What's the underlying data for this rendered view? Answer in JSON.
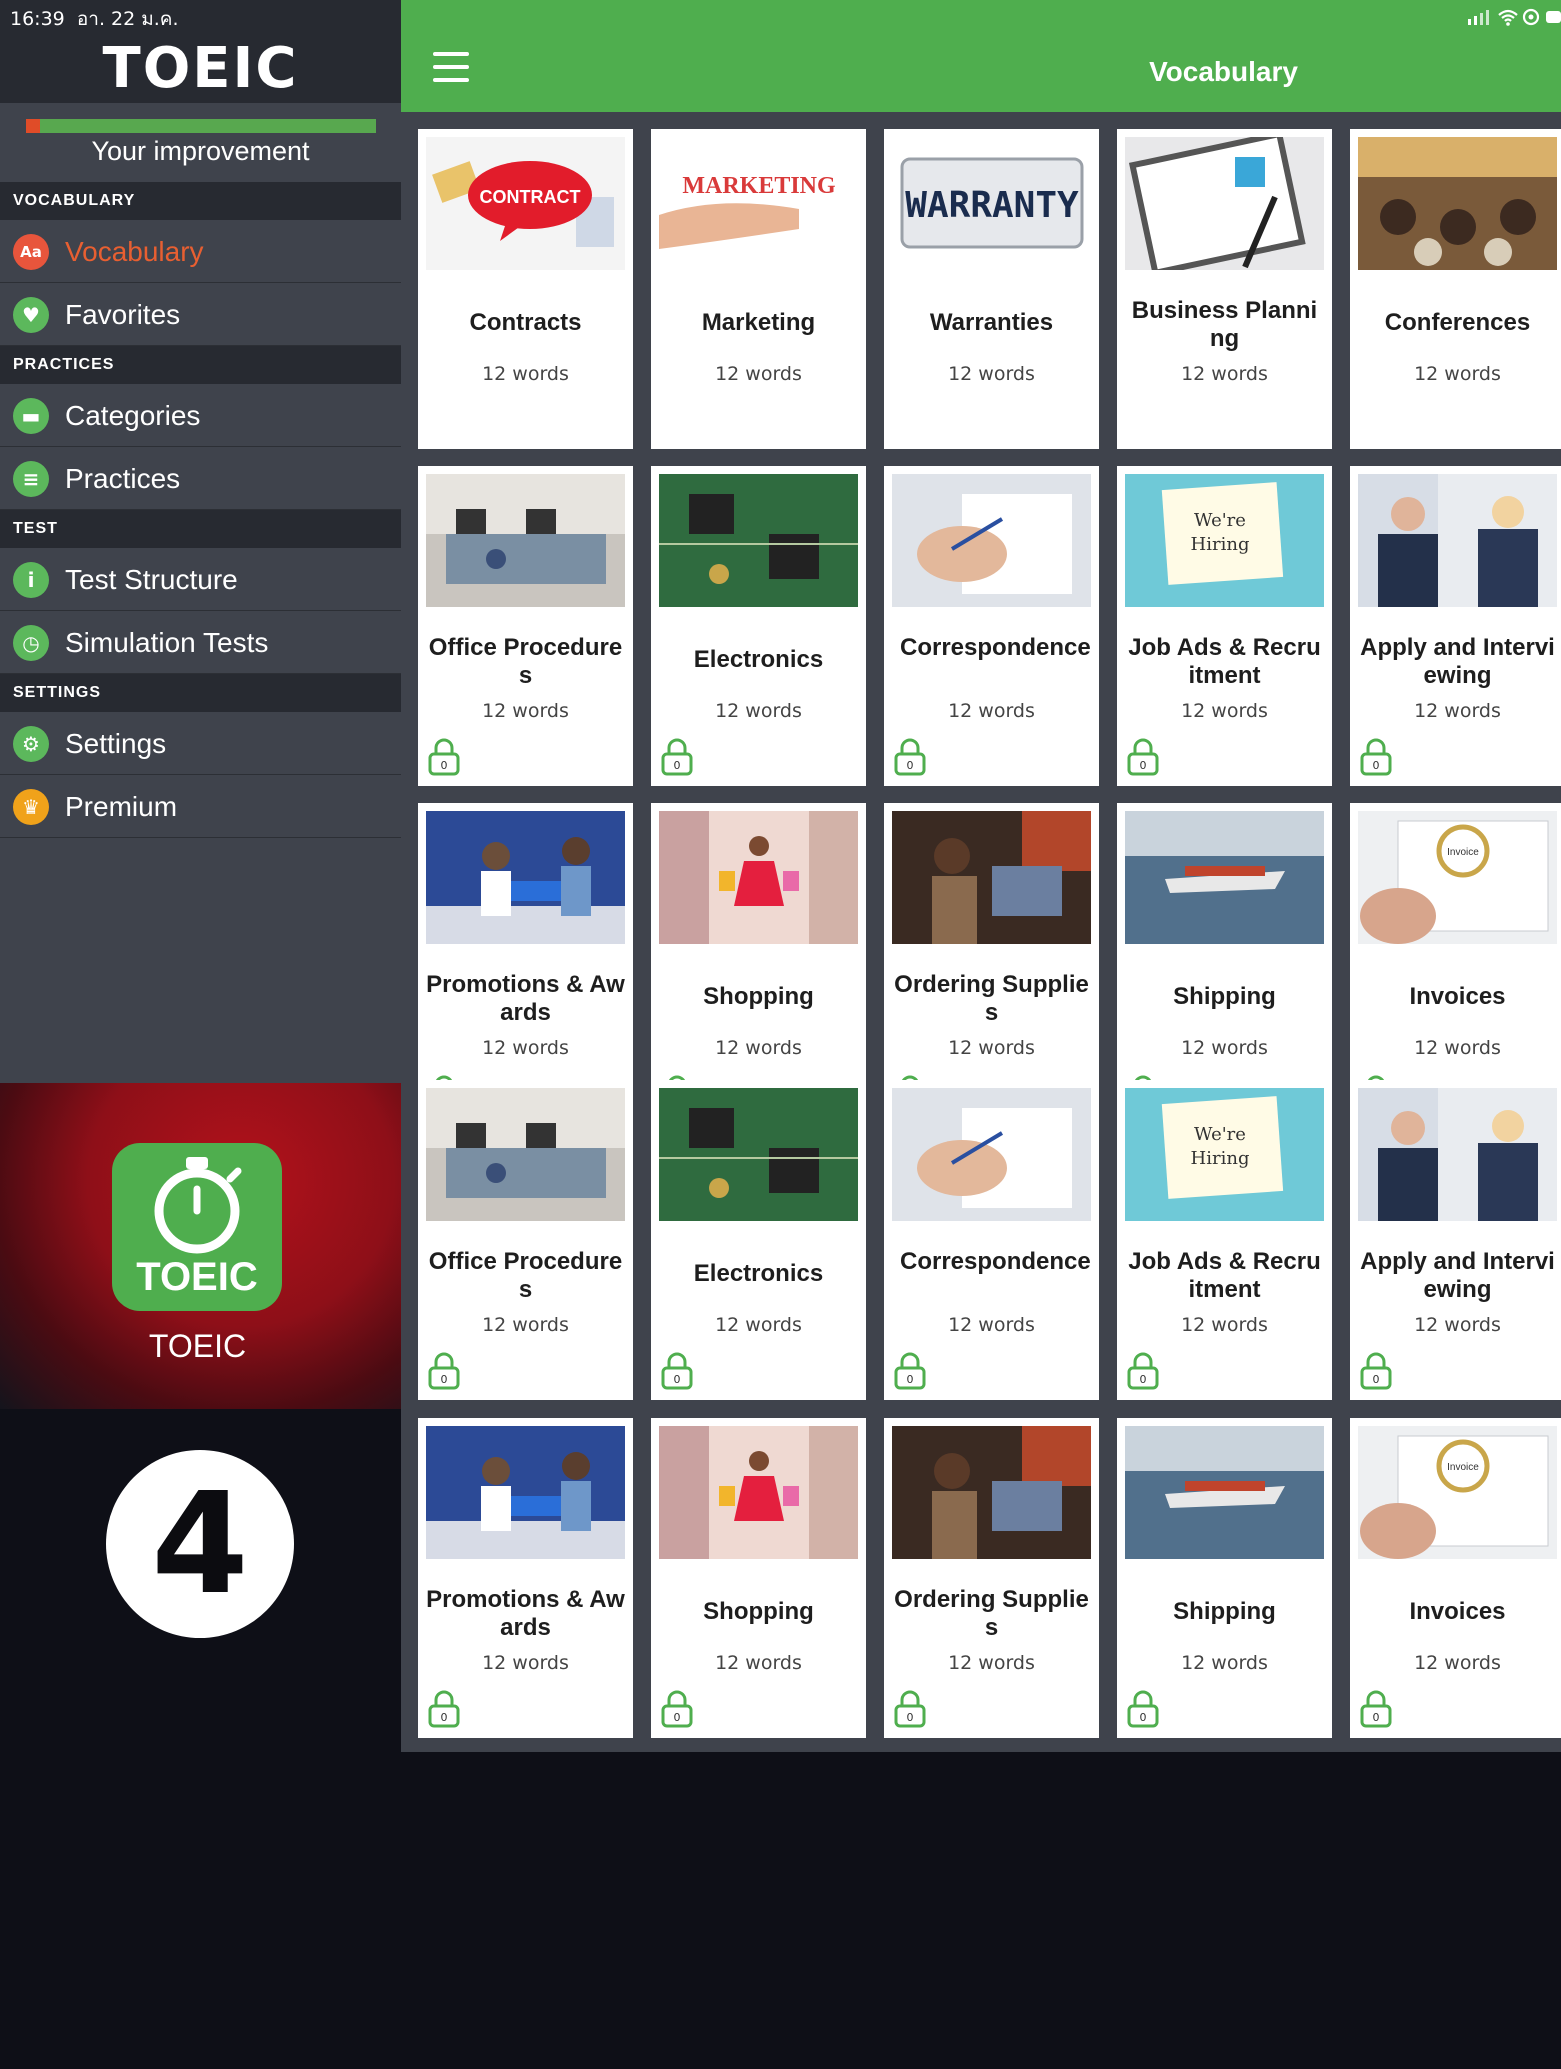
{
  "status_bar": {
    "time": "16:39",
    "date": "อา. 22 ม.ค."
  },
  "app": {
    "logo_text": "TOEIC"
  },
  "sidebar": {
    "improvement_label": "Your improvement",
    "improvement_progress": 0.04,
    "sections": [
      {
        "label": "VOCABULARY",
        "items": [
          {
            "label": "Vocabulary",
            "icon": "vocabulary-book-icon",
            "active": true
          },
          {
            "label": "Favorites",
            "icon": "heart-icon",
            "active": false
          }
        ]
      },
      {
        "label": "PRACTICES",
        "items": [
          {
            "label": "Categories",
            "icon": "folder-icon",
            "active": false
          },
          {
            "label": "Practices",
            "icon": "clipboard-icon",
            "active": false
          }
        ]
      },
      {
        "label": "TEST",
        "items": [
          {
            "label": "Test Structure",
            "icon": "info-icon",
            "active": false
          },
          {
            "label": "Simulation Tests",
            "icon": "stopwatch-icon",
            "active": false
          }
        ]
      },
      {
        "label": "SETTINGS",
        "items": [
          {
            "label": "Settings",
            "icon": "gear-icon",
            "active": false
          },
          {
            "label": "Premium",
            "icon": "crown-icon",
            "active": false
          }
        ]
      }
    ]
  },
  "header": {
    "title": "Vocabulary"
  },
  "promo": {
    "badge_text": "TOEIC",
    "title": "TOEIC",
    "step_number": "4"
  },
  "lock_count": "0",
  "rows": [
    [
      {
        "title": "Contracts",
        "count": "12 words",
        "locked": false,
        "img": "contract"
      },
      {
        "title": "Marketing",
        "count": "12 words",
        "locked": false,
        "img": "marketing"
      },
      {
        "title": "Warranties",
        "count": "12 words",
        "locked": false,
        "img": "warranty"
      },
      {
        "title": "Business Planning",
        "count": "12 words",
        "locked": false,
        "img": "plan"
      },
      {
        "title": "Conferences",
        "count": "12 words",
        "locked": false,
        "img": "conference"
      }
    ],
    [
      {
        "title": "Office Procedures",
        "count": "12 words",
        "locked": true,
        "img": "office"
      },
      {
        "title": "Electronics",
        "count": "12 words",
        "locked": true,
        "img": "circuit"
      },
      {
        "title": "Correspondence",
        "count": "12 words",
        "locked": true,
        "img": "writing"
      },
      {
        "title": "Job Ads & Recruitment",
        "count": "12 words",
        "locked": true,
        "img": "hiring"
      },
      {
        "title": "Apply and Interviewing",
        "count": "12 words",
        "locked": true,
        "img": "interview"
      }
    ],
    [
      {
        "title": "Promotions & Awards",
        "count": "12 words",
        "locked": true,
        "img": "award"
      },
      {
        "title": "Shopping",
        "count": "12 words",
        "locked": true,
        "img": "shopping"
      },
      {
        "title": "Ordering Supplies",
        "count": "12 words",
        "locked": true,
        "img": "ordering"
      },
      {
        "title": "Shipping",
        "count": "12 words",
        "locked": true,
        "img": "ship"
      },
      {
        "title": "Invoices",
        "count": "12 words",
        "locked": true,
        "img": "invoice"
      }
    ],
    [
      {
        "title": "Office Procedures",
        "count": "12 words",
        "locked": true,
        "img": "office"
      },
      {
        "title": "Electronics",
        "count": "12 words",
        "locked": true,
        "img": "circuit"
      },
      {
        "title": "Correspondence",
        "count": "12 words",
        "locked": true,
        "img": "writing"
      },
      {
        "title": "Job Ads & Recruitment",
        "count": "12 words",
        "locked": true,
        "img": "hiring"
      },
      {
        "title": "Apply and Interviewing",
        "count": "12 words",
        "locked": true,
        "img": "interview"
      }
    ],
    [
      {
        "title": "Promotions & Awards",
        "count": "12 words",
        "locked": true,
        "img": "award"
      },
      {
        "title": "Shopping",
        "count": "12 words",
        "locked": true,
        "img": "shopping"
      },
      {
        "title": "Ordering Supplies",
        "count": "12 words",
        "locked": true,
        "img": "ordering"
      },
      {
        "title": "Shipping",
        "count": "12 words",
        "locked": true,
        "img": "ship"
      },
      {
        "title": "Invoices",
        "count": "12 words",
        "locked": true,
        "img": "invoice"
      }
    ]
  ],
  "colors": {
    "accent_green": "#4fae4e",
    "active_orange": "#e85f31",
    "sidebar_bg": "#3f434c",
    "section_bg": "#272a31"
  }
}
